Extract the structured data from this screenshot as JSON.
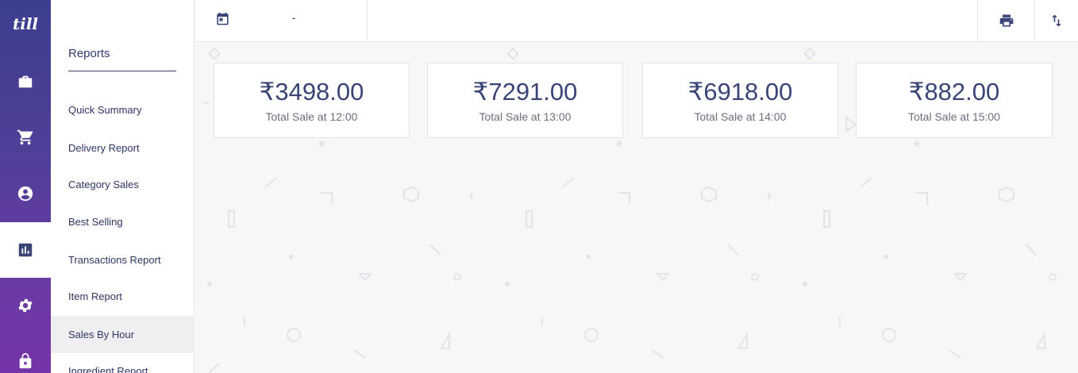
{
  "app": {
    "logo": "till"
  },
  "rail": {
    "items": [
      {
        "icon": "briefcase-icon"
      },
      {
        "icon": "cart-icon"
      },
      {
        "icon": "account-icon"
      },
      {
        "icon": "chart-icon",
        "active": true
      },
      {
        "icon": "gear-icon"
      },
      {
        "icon": "lock-icon"
      }
    ]
  },
  "sidebar": {
    "heading": "Reports",
    "items": [
      {
        "label": "Quick Summary"
      },
      {
        "label": "Delivery Report"
      },
      {
        "label": "Category Sales"
      },
      {
        "label": "Best Selling"
      },
      {
        "label": "Transactions Report"
      },
      {
        "label": "Item Report"
      },
      {
        "label": "Sales By Hour",
        "selected": true
      },
      {
        "label": "Ingredient Report"
      }
    ]
  },
  "topbar": {
    "date_separator": "-"
  },
  "cards": [
    {
      "amount": "₹3498.00",
      "label": "Total Sale at 12:00"
    },
    {
      "amount": "₹7291.00",
      "label": "Total Sale at 13:00"
    },
    {
      "amount": "₹6918.00",
      "label": "Total Sale at 14:00"
    },
    {
      "amount": "₹882.00",
      "label": "Total Sale at 15:00"
    }
  ],
  "colors": {
    "accent": "#3a4577",
    "rail_top": "#3b3f8f",
    "rail_bottom": "#7433a8"
  }
}
